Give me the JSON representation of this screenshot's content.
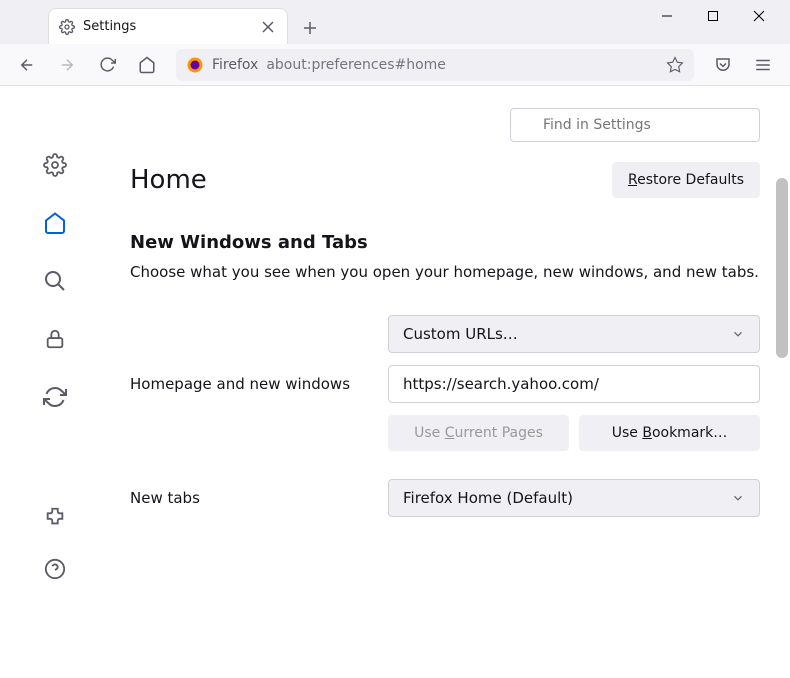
{
  "tab": {
    "title": "Settings"
  },
  "urlbar": {
    "brand": "Firefox",
    "url": "about:preferences#home"
  },
  "search": {
    "placeholder": "Find in Settings"
  },
  "page": {
    "title": "Home",
    "restore_defaults": "Restore Defaults"
  },
  "section": {
    "title": "New Windows and Tabs",
    "desc": "Choose what you see when you open your homepage, new windows, and new tabs."
  },
  "homepage": {
    "label": "Homepage and new windows",
    "dropdown_value": "Custom URLs…",
    "url_value": "https://search.yahoo.com/",
    "use_current": "Use Current Pages",
    "use_bookmark": "Use Bookmark…"
  },
  "newtabs": {
    "label": "New tabs",
    "dropdown_value": "Firefox Home (Default)"
  }
}
